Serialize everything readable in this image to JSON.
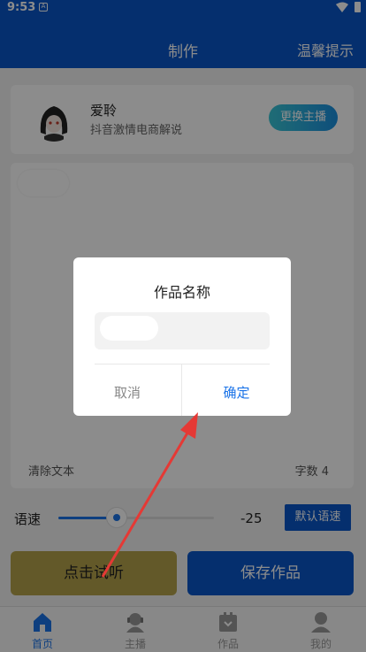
{
  "status": {
    "time": "9:53",
    "sim": "A"
  },
  "header": {
    "title": "制作",
    "right": "温馨提示"
  },
  "anchor": {
    "name": "爱聆",
    "desc": "抖音激情电商解说",
    "change_btn": "更换主播"
  },
  "text_area": {
    "clear": "清除文本",
    "count": "字数 4"
  },
  "speed": {
    "label": "语速",
    "value": "-25",
    "default_btn": "默认语速",
    "level_fraction": 0.38
  },
  "actions": {
    "listen": "点击试听",
    "save": "保存作品"
  },
  "nav": [
    {
      "label": "首页",
      "icon": "home-icon",
      "active": true
    },
    {
      "label": "主播",
      "icon": "anchor-icon",
      "active": false
    },
    {
      "label": "作品",
      "icon": "works-icon",
      "active": false
    },
    {
      "label": "我的",
      "icon": "profile-icon",
      "active": false
    }
  ],
  "dialog": {
    "title": "作品名称",
    "cancel": "取消",
    "confirm": "确定"
  },
  "colors": {
    "primary": "#0a57c8",
    "accent": "#1a73e8",
    "listen_button": "#b4a24c",
    "arrow": "#e53935"
  }
}
